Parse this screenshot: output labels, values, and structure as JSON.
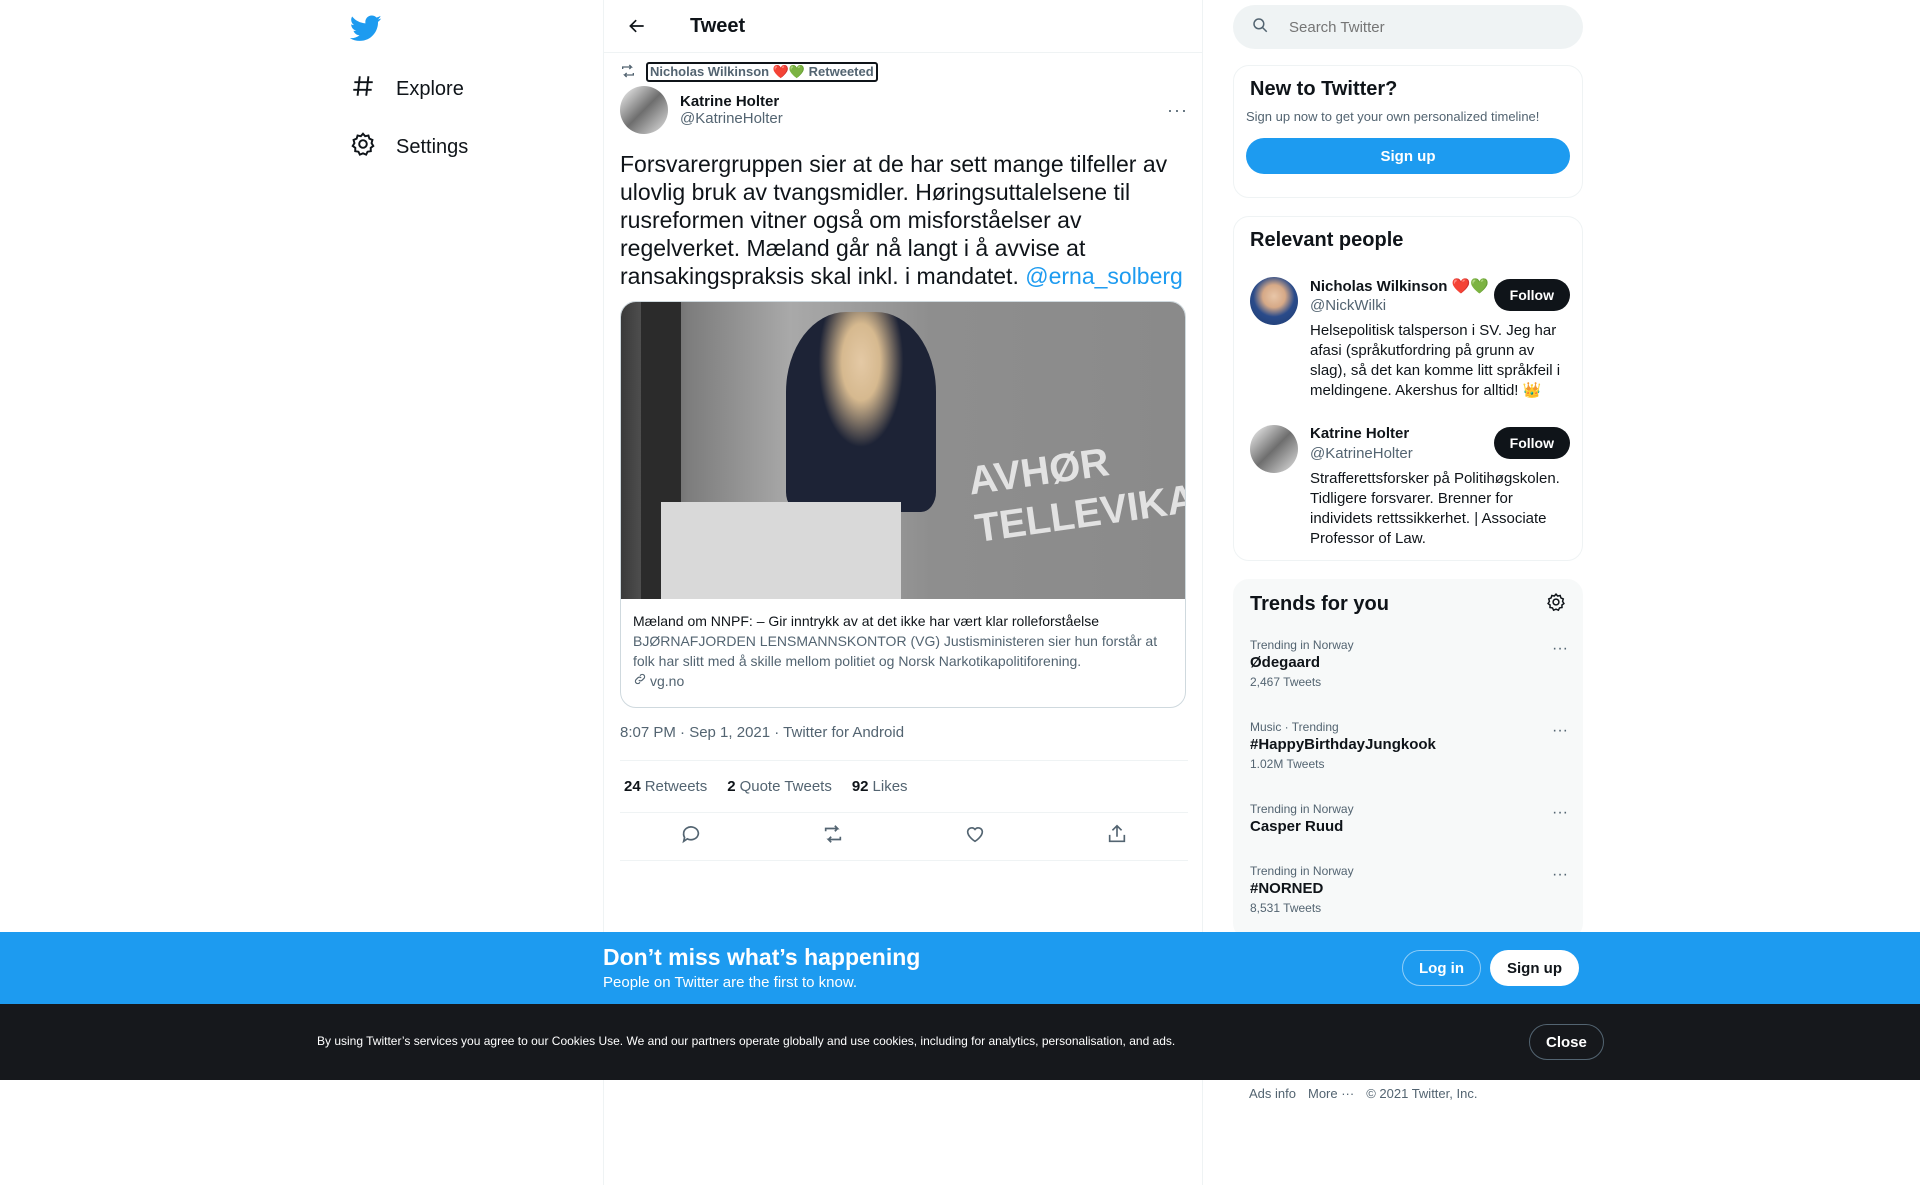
{
  "nav": {
    "explore_label": "Explore",
    "settings_label": "Settings"
  },
  "header": {
    "title": "Tweet"
  },
  "tweet": {
    "retweeted_by": "Nicholas Wilkinson ❤️💚 Retweeted",
    "author_name": "Katrine Holter",
    "author_handle": "@KatrineHolter",
    "text": "Forsvarergruppen sier at de har sett mange tilfeller av ulovlig bruk av tvangsmidler. Høringsuttalelsene til rusreformen vitner også om misforståelser av regelverket. Mæland går nå langt i å avvise at ransakingspraksis skal inkl. i mandatet.",
    "mention": "@erna_solberg",
    "card": {
      "image_text": "AVHØR TELLEVIKA",
      "title": "Mæland om NNPF: – Gir inntrykk av at det ikke har vært klar rolleforståelse",
      "description": "BJØRNAFJORDEN LENSMANNSKONTOR (VG) Justisministeren sier hun forstår at folk har slitt med å skille mellom politiet og Norsk Narkotikapolitiforening.",
      "domain": "vg.no"
    },
    "meta": "8:07 PM · Sep 1, 2021 · Twitter for Android",
    "stats": {
      "retweets_count": "24",
      "retweets_label": "Retweets",
      "quotes_count": "2",
      "quotes_label": "Quote Tweets",
      "likes_count": "92",
      "likes_label": "Likes"
    }
  },
  "search": {
    "placeholder": "Search Twitter"
  },
  "new_to_twitter": {
    "title": "New to Twitter?",
    "subtitle": "Sign up now to get your own personalized timeline!",
    "signup_label": "Sign up"
  },
  "relevant_people": {
    "title": "Relevant people",
    "people": [
      {
        "name": "Nicholas Wilkinson ❤️💚",
        "handle": "@NickWilki",
        "bio": "Helsepolitisk talsperson i SV. Jeg har afasi (språkutfordring på grunn av slag), så det kan komme litt språkfeil i meldingene. Akershus for alltid! 👑",
        "follow_label": "Follow"
      },
      {
        "name": "Katrine Holter",
        "handle": "@KatrineHolter",
        "bio": "Strafferettsforsker på Politihøgskolen. Tidligere forsvarer. Brenner for individets rettssikkerhet. | Associate Professor of Law.",
        "follow_label": "Follow"
      }
    ]
  },
  "trends": {
    "title": "Trends for you",
    "items": [
      {
        "context": "Trending in Norway",
        "name": "Ødegaard",
        "count": "2,467 Tweets"
      },
      {
        "context": "Music · Trending",
        "name": "#HappyBirthdayJungkook",
        "count": "1.02M Tweets"
      },
      {
        "context": "Trending in Norway",
        "name": "Casper Ruud",
        "count": ""
      },
      {
        "context": "Trending in Norway",
        "name": "#NORNED",
        "count": "8,531 Tweets"
      }
    ]
  },
  "footer": {
    "ads_info": "Ads info",
    "more": "More ···",
    "copyright": "© 2021 Twitter, Inc."
  },
  "banner": {
    "title": "Don’t miss what’s happening",
    "subtitle": "People on Twitter are the first to know.",
    "login_label": "Log in",
    "signup_label": "Sign up"
  },
  "cookie": {
    "text": "By using Twitter’s services you agree to our Cookies Use. We and our partners operate globally and use cookies, including for analytics, personalisation, and ads.",
    "close_label": "Close"
  },
  "colors": {
    "accent": "#1d9bf0",
    "text": "#0f1419",
    "secondary": "#536471",
    "cookie_bg": "#16181c"
  }
}
